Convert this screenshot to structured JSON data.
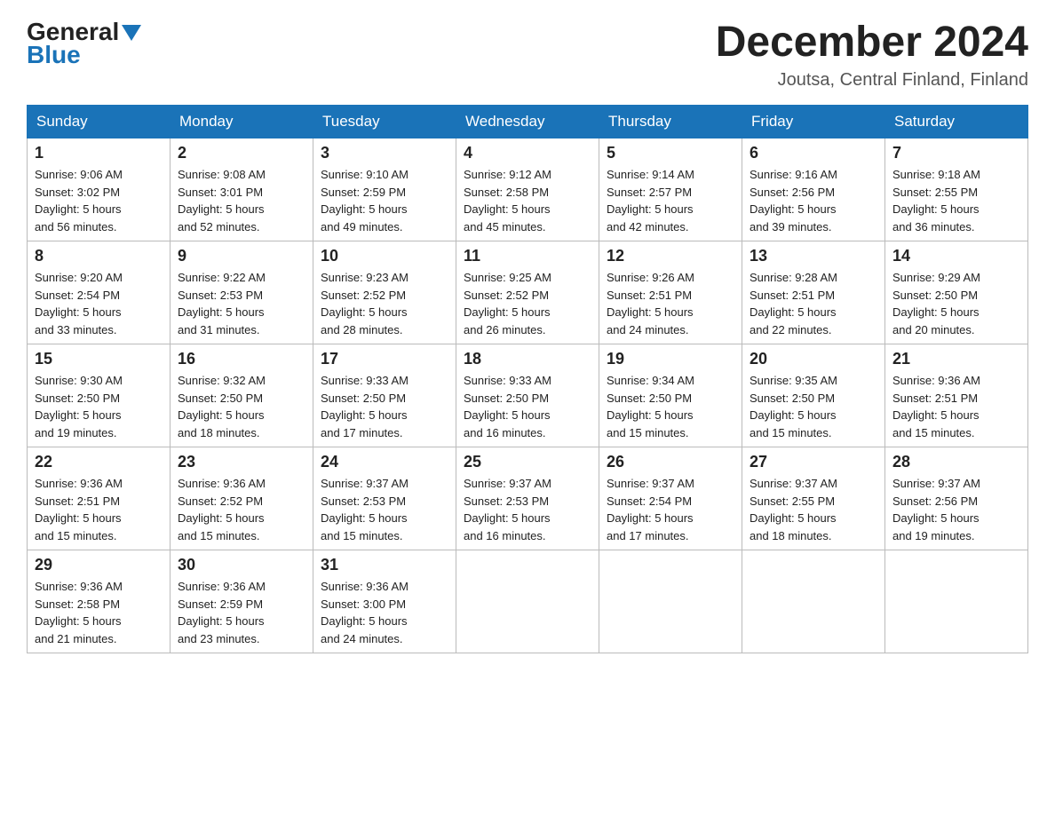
{
  "header": {
    "logo_general": "General",
    "logo_blue": "Blue",
    "title": "December 2024",
    "subtitle": "Joutsa, Central Finland, Finland"
  },
  "days_of_week": [
    "Sunday",
    "Monday",
    "Tuesday",
    "Wednesday",
    "Thursday",
    "Friday",
    "Saturday"
  ],
  "weeks": [
    [
      {
        "day": "1",
        "sunrise": "9:06 AM",
        "sunset": "3:02 PM",
        "daylight": "5 hours and 56 minutes."
      },
      {
        "day": "2",
        "sunrise": "9:08 AM",
        "sunset": "3:01 PM",
        "daylight": "5 hours and 52 minutes."
      },
      {
        "day": "3",
        "sunrise": "9:10 AM",
        "sunset": "2:59 PM",
        "daylight": "5 hours and 49 minutes."
      },
      {
        "day": "4",
        "sunrise": "9:12 AM",
        "sunset": "2:58 PM",
        "daylight": "5 hours and 45 minutes."
      },
      {
        "day": "5",
        "sunrise": "9:14 AM",
        "sunset": "2:57 PM",
        "daylight": "5 hours and 42 minutes."
      },
      {
        "day": "6",
        "sunrise": "9:16 AM",
        "sunset": "2:56 PM",
        "daylight": "5 hours and 39 minutes."
      },
      {
        "day": "7",
        "sunrise": "9:18 AM",
        "sunset": "2:55 PM",
        "daylight": "5 hours and 36 minutes."
      }
    ],
    [
      {
        "day": "8",
        "sunrise": "9:20 AM",
        "sunset": "2:54 PM",
        "daylight": "5 hours and 33 minutes."
      },
      {
        "day": "9",
        "sunrise": "9:22 AM",
        "sunset": "2:53 PM",
        "daylight": "5 hours and 31 minutes."
      },
      {
        "day": "10",
        "sunrise": "9:23 AM",
        "sunset": "2:52 PM",
        "daylight": "5 hours and 28 minutes."
      },
      {
        "day": "11",
        "sunrise": "9:25 AM",
        "sunset": "2:52 PM",
        "daylight": "5 hours and 26 minutes."
      },
      {
        "day": "12",
        "sunrise": "9:26 AM",
        "sunset": "2:51 PM",
        "daylight": "5 hours and 24 minutes."
      },
      {
        "day": "13",
        "sunrise": "9:28 AM",
        "sunset": "2:51 PM",
        "daylight": "5 hours and 22 minutes."
      },
      {
        "day": "14",
        "sunrise": "9:29 AM",
        "sunset": "2:50 PM",
        "daylight": "5 hours and 20 minutes."
      }
    ],
    [
      {
        "day": "15",
        "sunrise": "9:30 AM",
        "sunset": "2:50 PM",
        "daylight": "5 hours and 19 minutes."
      },
      {
        "day": "16",
        "sunrise": "9:32 AM",
        "sunset": "2:50 PM",
        "daylight": "5 hours and 18 minutes."
      },
      {
        "day": "17",
        "sunrise": "9:33 AM",
        "sunset": "2:50 PM",
        "daylight": "5 hours and 17 minutes."
      },
      {
        "day": "18",
        "sunrise": "9:33 AM",
        "sunset": "2:50 PM",
        "daylight": "5 hours and 16 minutes."
      },
      {
        "day": "19",
        "sunrise": "9:34 AM",
        "sunset": "2:50 PM",
        "daylight": "5 hours and 15 minutes."
      },
      {
        "day": "20",
        "sunrise": "9:35 AM",
        "sunset": "2:50 PM",
        "daylight": "5 hours and 15 minutes."
      },
      {
        "day": "21",
        "sunrise": "9:36 AM",
        "sunset": "2:51 PM",
        "daylight": "5 hours and 15 minutes."
      }
    ],
    [
      {
        "day": "22",
        "sunrise": "9:36 AM",
        "sunset": "2:51 PM",
        "daylight": "5 hours and 15 minutes."
      },
      {
        "day": "23",
        "sunrise": "9:36 AM",
        "sunset": "2:52 PM",
        "daylight": "5 hours and 15 minutes."
      },
      {
        "day": "24",
        "sunrise": "9:37 AM",
        "sunset": "2:53 PM",
        "daylight": "5 hours and 15 minutes."
      },
      {
        "day": "25",
        "sunrise": "9:37 AM",
        "sunset": "2:53 PM",
        "daylight": "5 hours and 16 minutes."
      },
      {
        "day": "26",
        "sunrise": "9:37 AM",
        "sunset": "2:54 PM",
        "daylight": "5 hours and 17 minutes."
      },
      {
        "day": "27",
        "sunrise": "9:37 AM",
        "sunset": "2:55 PM",
        "daylight": "5 hours and 18 minutes."
      },
      {
        "day": "28",
        "sunrise": "9:37 AM",
        "sunset": "2:56 PM",
        "daylight": "5 hours and 19 minutes."
      }
    ],
    [
      {
        "day": "29",
        "sunrise": "9:36 AM",
        "sunset": "2:58 PM",
        "daylight": "5 hours and 21 minutes."
      },
      {
        "day": "30",
        "sunrise": "9:36 AM",
        "sunset": "2:59 PM",
        "daylight": "5 hours and 23 minutes."
      },
      {
        "day": "31",
        "sunrise": "9:36 AM",
        "sunset": "3:00 PM",
        "daylight": "5 hours and 24 minutes."
      },
      null,
      null,
      null,
      null
    ]
  ],
  "labels": {
    "sunrise": "Sunrise:",
    "sunset": "Sunset:",
    "daylight": "Daylight:"
  }
}
